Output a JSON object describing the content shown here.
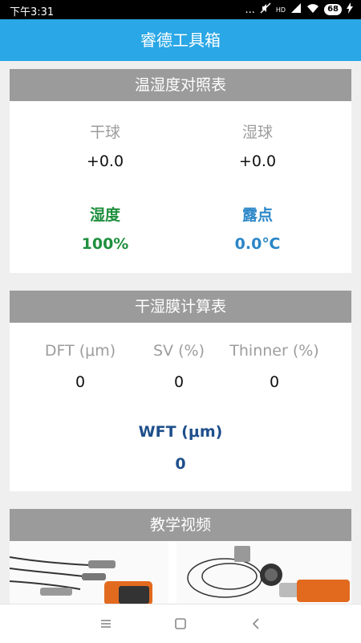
{
  "status": {
    "time": "下午3:31",
    "signal": "...",
    "hd": "HD",
    "battery": "68"
  },
  "app": {
    "title": "睿德工具箱"
  },
  "humidity_card": {
    "title": "温湿度对照表",
    "dry_label": "干球",
    "wet_label": "湿球",
    "dry_value": "+0.0",
    "wet_value": "+0.0",
    "humidity_label": "湿度",
    "dewpoint_label": "露点",
    "humidity_value": "100%",
    "dewpoint_value": "0.0℃",
    "colors": {
      "humidity": "#1e8f3d",
      "dewpoint": "#2a86c7"
    }
  },
  "film_card": {
    "title": "干湿膜计算表",
    "dft_label": "DFT (μm)",
    "sv_label": "SV (%)",
    "thinner_label": "Thinner (%)",
    "dft_value": "0",
    "sv_value": "0",
    "thinner_value": "0",
    "wft_label": "WFT (μm)",
    "wft_value": "0",
    "colors": {
      "wft": "#1f4f8c"
    }
  },
  "video_card": {
    "title": "教学视频",
    "thumbnails": [
      "coating-thickness-gauge-icon",
      "pressure-gauge-icon"
    ]
  },
  "navbar": {
    "icons": [
      "menu-icon",
      "home-icon",
      "back-icon"
    ]
  },
  "colors": {
    "appbar": "#2aa7e6",
    "card_header": "#9b9b9b",
    "background": "#efefef"
  }
}
